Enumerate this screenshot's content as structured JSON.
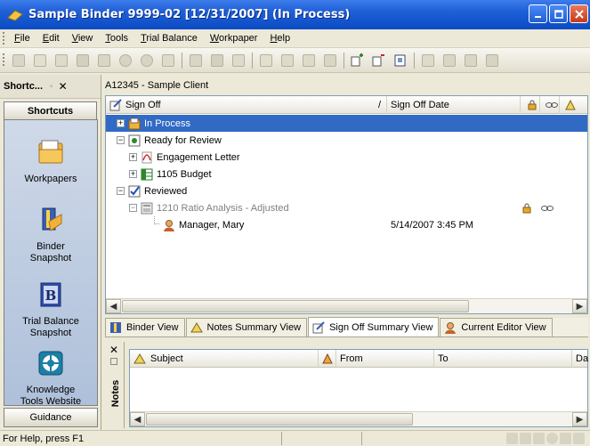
{
  "window": {
    "title": "Sample Binder 9999-02 [12/31/2007] (In Process)"
  },
  "menu": [
    {
      "label": "File",
      "key": "F",
      "rest": "ile"
    },
    {
      "label": "Edit",
      "key": "E",
      "rest": "dit"
    },
    {
      "label": "View",
      "key": "V",
      "rest": "iew"
    },
    {
      "label": "Tools",
      "key": "T",
      "rest": "ools"
    },
    {
      "label": "Trial Balance",
      "key": "T",
      "rest": "rial Balance"
    },
    {
      "label": "Workpaper",
      "key": "W",
      "rest": "orkpaper"
    },
    {
      "label": "Help",
      "key": "H",
      "rest": "elp"
    }
  ],
  "left_pane": {
    "title": "Shortc...",
    "tab": "Shortcuts",
    "items": [
      {
        "label": "Workpapers",
        "icon": "folder-icon"
      },
      {
        "label": "Binder\nSnapshot",
        "icon": "binder-snapshot-icon"
      },
      {
        "label": "Trial Balance\nSnapshot",
        "icon": "trial-balance-icon"
      },
      {
        "label": "Knowledge\nTools Website",
        "icon": "globe-icon"
      }
    ],
    "bottom_tab": "Guidance"
  },
  "client": "A12345 - Sample Client",
  "tree": {
    "columns": {
      "signoff": "Sign Off",
      "sort_mark": "/",
      "signoff_date": "Sign Off Date"
    },
    "rows": [
      {
        "label": "In Process",
        "date": ""
      },
      {
        "label": "Ready for Review",
        "date": ""
      },
      {
        "label": "Engagement Letter",
        "date": ""
      },
      {
        "label": "1105 Budget",
        "date": ""
      },
      {
        "label": "Reviewed",
        "date": ""
      },
      {
        "label": "1210 Ratio Analysis - Adjusted",
        "date": ""
      },
      {
        "label": "Manager, Mary",
        "date": "5/14/2007 3:45 PM"
      }
    ]
  },
  "view_tabs": [
    {
      "label": "Binder View"
    },
    {
      "label": "Notes Summary View"
    },
    {
      "label": "Sign Off Summary View",
      "active": true
    },
    {
      "label": "Current Editor View"
    }
  ],
  "notes": {
    "label": "Notes",
    "columns": {
      "subject": "Subject",
      "from": "From",
      "to": "To",
      "date": "Da"
    }
  },
  "status": {
    "text": "For Help, press F1"
  },
  "colors": {
    "title_blue": "#0a4ac3",
    "selection": "#316ac5",
    "face": "#ece9d8"
  }
}
